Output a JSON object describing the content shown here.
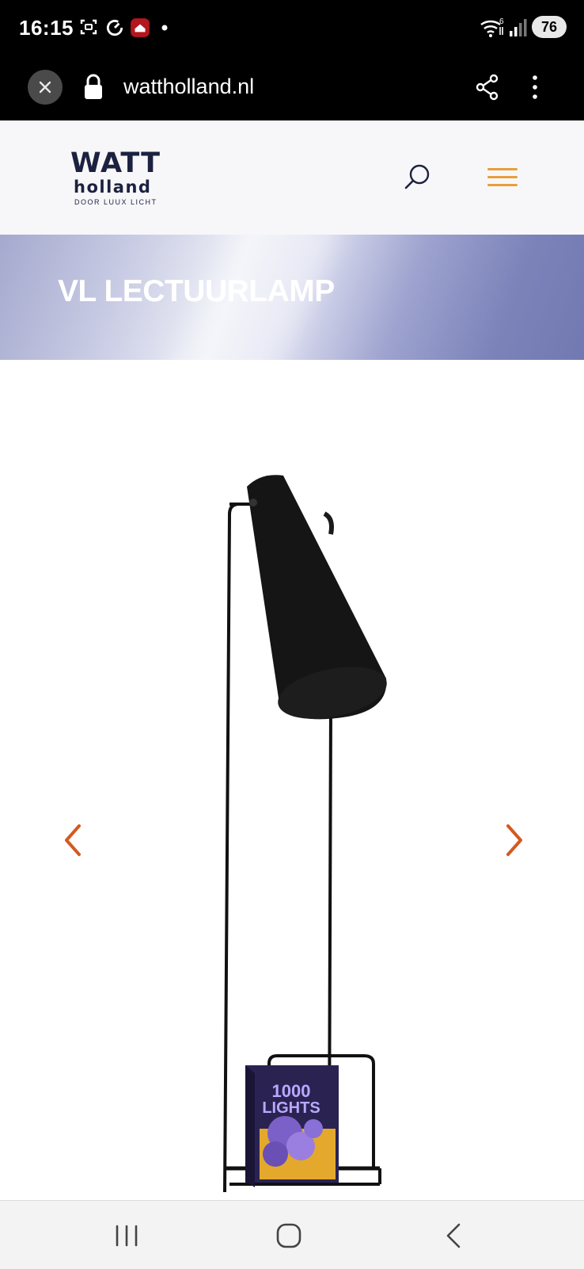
{
  "status_bar": {
    "time": "16:15",
    "battery": "76",
    "network_badge": "6",
    "icons": [
      "screenshot-icon",
      "sync-icon",
      "app-notification-icon",
      "dot-icon",
      "wifi-icon",
      "signal-icon",
      "battery-icon"
    ]
  },
  "browser": {
    "url": "wattholland.nl",
    "icons": [
      "close-icon",
      "lock-icon",
      "share-icon",
      "more-vert-icon"
    ]
  },
  "header": {
    "logo_top": "WATT",
    "logo_bottom": "holland",
    "logo_tagline": "DOOR LUUX LICHT",
    "icons": [
      "search-icon",
      "hamburger-menu-icon"
    ],
    "accent_color": "#e89e3c"
  },
  "banner": {
    "title": "VL LECTUURLAMP"
  },
  "gallery": {
    "icons": [
      "chevron-left-icon",
      "chevron-right-icon"
    ],
    "book_title_line1": "1000",
    "book_title_line2": "LIGHTS",
    "arrow_color": "#d35a22"
  },
  "nav_bar": {
    "icons": [
      "recent-apps-icon",
      "home-icon",
      "back-icon"
    ]
  }
}
